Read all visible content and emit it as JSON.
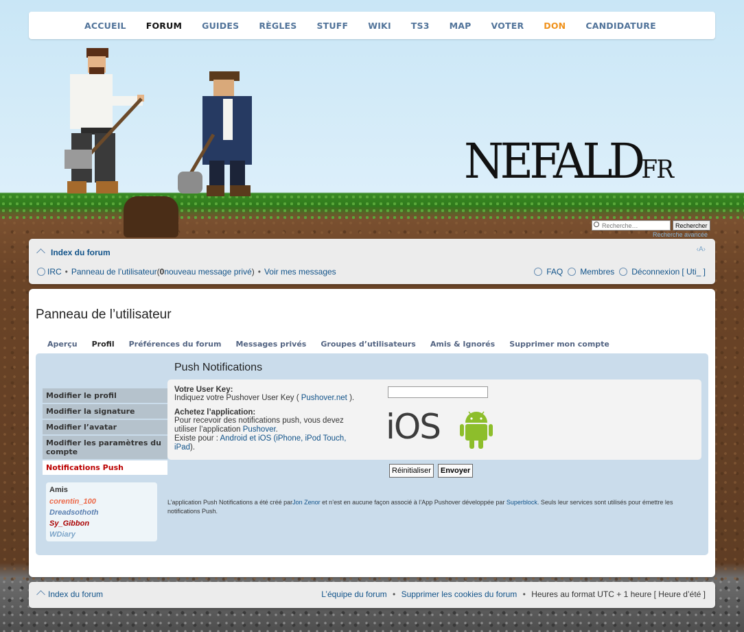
{
  "topnav": {
    "items": [
      "ACCUEIL",
      "FORUM",
      "GUIDES",
      "RÈGLES",
      "STUFF",
      "WIKI",
      "TS3",
      "MAP",
      "VOTER",
      "DON",
      "CANDIDATURE"
    ]
  },
  "logo": {
    "main": "NEFALD",
    "suffix": "FR"
  },
  "search": {
    "placeholder": "Recherche…",
    "button": "Rechercher",
    "advanced": "Recherche avancée"
  },
  "navbar": {
    "index": "Index du forum",
    "fontsize": "‹A›",
    "irc": "IRC",
    "ucp": "Panneau de l’utilisateur",
    "ucp_open": " (",
    "pm_count": "0",
    "pm_text": " nouveau message privé ",
    "ucp_close": ")",
    "view_msgs": "Voir mes messages",
    "faq": "FAQ",
    "members": "Membres",
    "logout": "Déconnexion",
    "logout_user": "[ Uti_ ]"
  },
  "panel": {
    "title": "Panneau de l’utilisateur",
    "tabs": [
      "Aperçu",
      "Profil",
      "Préférences du forum",
      "Messages privés",
      "Groupes d’utilisateurs",
      "Amis & Ignorés",
      "Supprimer mon compte"
    ],
    "menu": [
      "Modifier le profil",
      "Modifier la signature",
      "Modifier l’avatar",
      "Modifier les paramètres du compte",
      "Notifications Push"
    ],
    "friends_title": "Amis",
    "friends": [
      {
        "name": "corentin_100",
        "color": "#ec6a4a"
      },
      {
        "name": "Dreadsothoth",
        "color": "#5a7fb0"
      },
      {
        "name": "Sy_Gibbon",
        "color": "#aa0000"
      },
      {
        "name": "WDiary",
        "color": "#7ba4c8"
      }
    ]
  },
  "push": {
    "title": "Push Notifications",
    "key_label": "Votre User Key:",
    "key_help_pre": "Indiquez votre Pushover User Key ( ",
    "key_help_link": "Pushover.net",
    "key_help_post": " ).",
    "buy_label": "Achetez l’application:",
    "buy_line1": "Pour recevoir des notifications push, vous devez",
    "buy_line2_pre": "utiliser l’application ",
    "buy_line2_link": "Pushover",
    "buy_line3_pre": "Existe pour : ",
    "buy_line3_link": "Android et iOS (iPhone, iPod Touch,",
    "buy_line4_link": "iPad",
    "ios": "iOS",
    "reset": "Réinitialiser",
    "submit": "Envoyer",
    "credit_pre": "L’application Push Notifications a été créé par",
    "credit_author": "Jon Zenor",
    "credit_mid": " et n’est en aucune façon associé à l’App Pushover développée par ",
    "credit_company": "Superblock",
    "credit_post": ". Seuls leur services sont utilisés pour émettre les notifications Push."
  },
  "footer": {
    "index": "Index du forum",
    "team": "L’équipe du forum",
    "cookies": "Supprimer les cookies du forum",
    "tz": "Heures au format UTC + 1 heure [ Heure d’été ]"
  }
}
